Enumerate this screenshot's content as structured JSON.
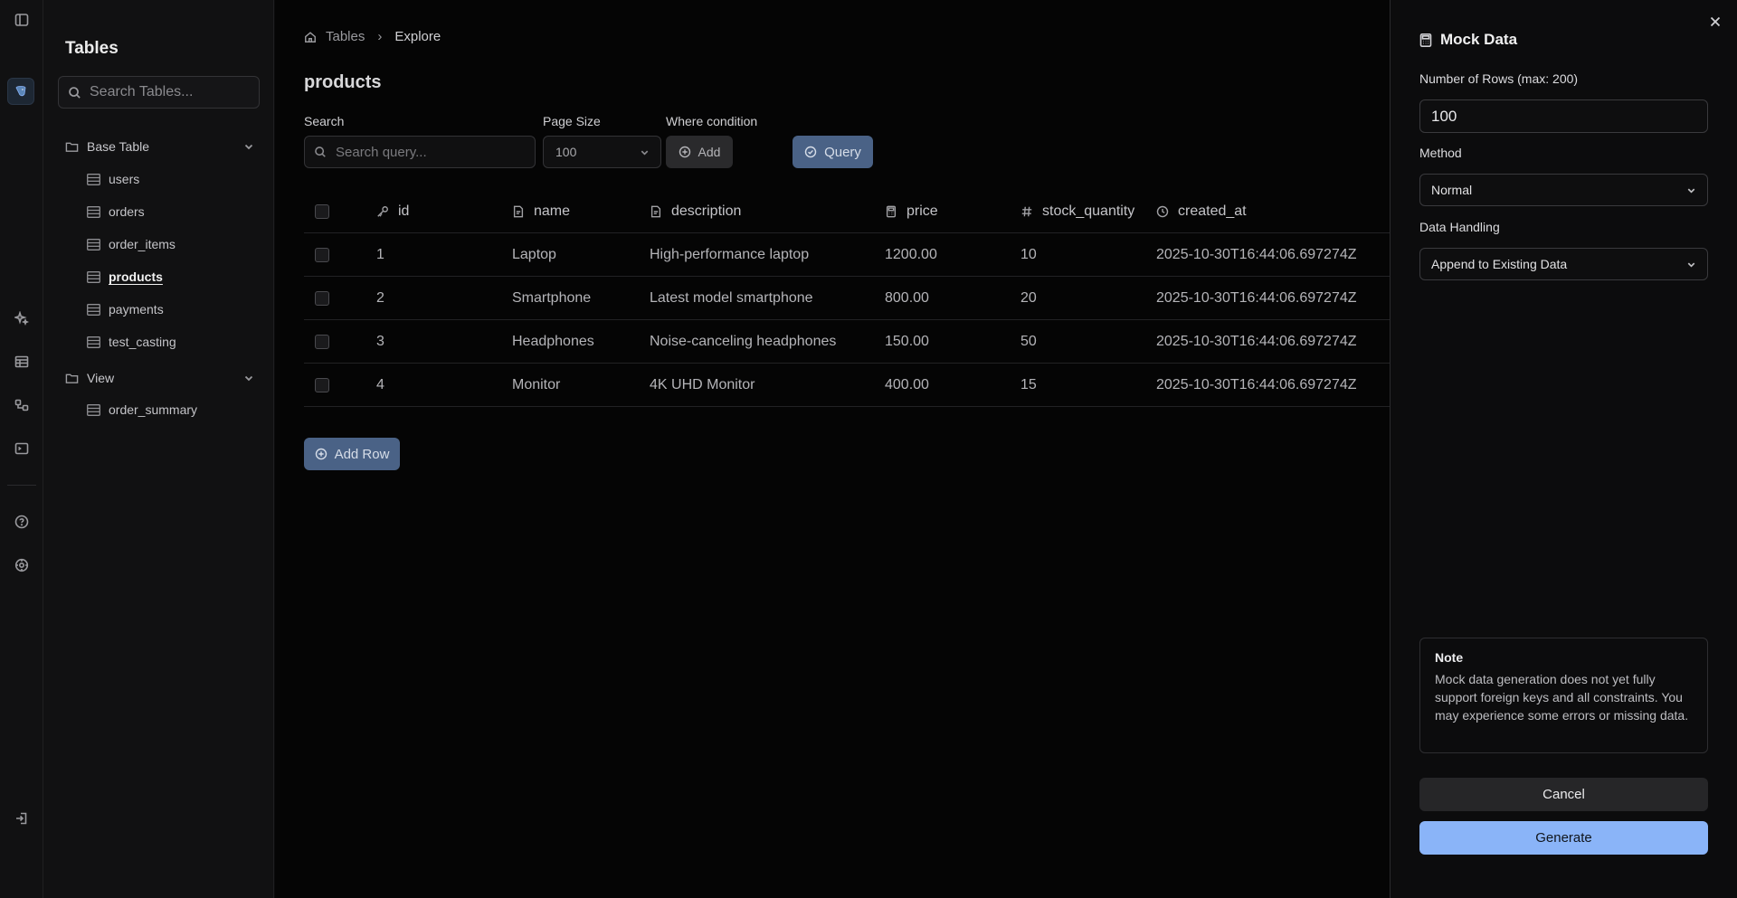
{
  "sidebar": {
    "title": "Tables",
    "search_placeholder": "Search Tables...",
    "groups": [
      {
        "label": "Base Table",
        "items": [
          "users",
          "orders",
          "order_items",
          "products",
          "payments",
          "test_casting"
        ]
      },
      {
        "label": "View",
        "items": [
          "order_summary"
        ]
      }
    ],
    "active_item": "products"
  },
  "breadcrumb": {
    "root": "Tables",
    "current": "Explore"
  },
  "main": {
    "title": "products",
    "search_label": "Search",
    "search_placeholder": "Search query...",
    "page_size_label": "Page Size",
    "page_size_value": "100",
    "where_label": "Where condition",
    "add_label": "Add",
    "query_label": "Query",
    "add_row_label": "Add Row"
  },
  "table": {
    "columns": [
      {
        "name": "id",
        "icon": "key-icon"
      },
      {
        "name": "name",
        "icon": "text-file-icon"
      },
      {
        "name": "description",
        "icon": "text-file-icon"
      },
      {
        "name": "price",
        "icon": "calculator-icon"
      },
      {
        "name": "stock_quantity",
        "icon": "hash-icon"
      },
      {
        "name": "created_at",
        "icon": "clock-icon"
      }
    ],
    "rows": [
      [
        "1",
        "Laptop",
        "High-performance laptop",
        "1200.00",
        "10",
        "2025-10-30T16:44:06.697274Z"
      ],
      [
        "2",
        "Smartphone",
        "Latest model smartphone",
        "800.00",
        "20",
        "2025-10-30T16:44:06.697274Z"
      ],
      [
        "3",
        "Headphones",
        "Noise-canceling headphones",
        "150.00",
        "50",
        "2025-10-30T16:44:06.697274Z"
      ],
      [
        "4",
        "Monitor",
        "4K UHD Monitor",
        "400.00",
        "15",
        "2025-10-30T16:44:06.697274Z"
      ]
    ]
  },
  "drawer": {
    "title": "Mock Data",
    "rows_label": "Number of Rows (max: 200)",
    "rows_value": "100",
    "method_label": "Method",
    "method_value": "Normal",
    "handling_label": "Data Handling",
    "handling_value": "Append to Existing Data",
    "note_title": "Note",
    "note_body": "Mock data generation does not yet fully support foreign keys and all constraints. You may experience some errors or missing data.",
    "cancel_label": "Cancel",
    "generate_label": "Generate"
  },
  "colors": {
    "accent": "#8ab4f8",
    "button_muted_blue": "#4a6286",
    "background": "#050505"
  }
}
